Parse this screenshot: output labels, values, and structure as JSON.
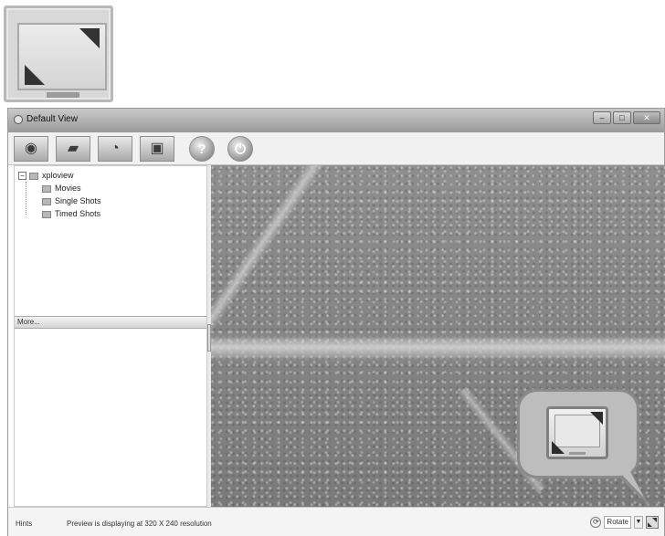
{
  "window": {
    "title": "Default View",
    "controls": {
      "minimize": "–",
      "maximize": "□",
      "close": "✕"
    }
  },
  "toolbar": {
    "buttons": [
      {
        "name": "camera-icon",
        "glyph": "◉"
      },
      {
        "name": "video-camera-icon",
        "glyph": "▰"
      },
      {
        "name": "timer-camera-icon",
        "glyph": "◔"
      },
      {
        "name": "movie-camera-icon",
        "glyph": "▣"
      },
      {
        "name": "help-icon",
        "glyph": "?"
      },
      {
        "name": "power-icon",
        "glyph": "⏻"
      }
    ]
  },
  "tree": {
    "root": {
      "toggle": "−",
      "label": "xploview"
    },
    "children": [
      {
        "label": "Movies"
      },
      {
        "label": "Single Shots"
      },
      {
        "label": "Timed Shots"
      }
    ]
  },
  "left_pane": {
    "more_label": "More..."
  },
  "statusbar": {
    "hints_label": "Hints",
    "message": "Preview is displaying at 320 X 240 resolution",
    "select_value": "Rotate",
    "refresh_glyph": "⟳",
    "dropdown_glyph": "▼"
  }
}
